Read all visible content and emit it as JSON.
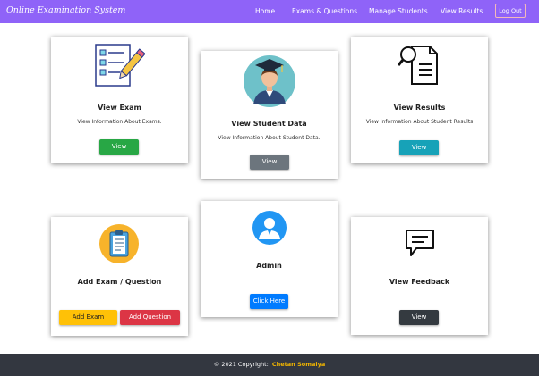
{
  "nav": {
    "brand": "Online Examination System",
    "links": [
      "Home",
      "Exams & Questions",
      "Manage Students",
      "View Results"
    ],
    "logout_label": "Log Out"
  },
  "cards": {
    "view_exam": {
      "title": "View Exam",
      "desc": "View Information About Exams.",
      "button": "View",
      "button_color": "#28a745",
      "icon": "checklist-pencil-icon"
    },
    "view_student": {
      "title": "View Student Data",
      "desc": "View Information About Student Data.",
      "button": "View",
      "button_color": "#6c757d",
      "icon": "student-avatar-icon"
    },
    "view_results": {
      "title": "View Results",
      "desc": "View Information About Student Results",
      "button": "View",
      "button_color": "#17a2b8",
      "icon": "document-search-icon"
    },
    "add_exam": {
      "title": "Add Exam / Question",
      "button_exam": "Add Exam",
      "button_exam_color": "#ffc107",
      "button_question": "Add Question",
      "button_question_color": "#dc3545",
      "icon": "clipboard-icon"
    },
    "admin": {
      "title": "Admin",
      "button": "Click Here",
      "button_color": "#007bff",
      "icon": "admin-user-icon"
    },
    "feedback": {
      "title": "View Feedback",
      "button": "View",
      "button_color": "#343a40",
      "icon": "speech-bubble-icon"
    }
  },
  "footer": {
    "copyright": "© 2021 Copyright:",
    "author": "Chetan Somaiya"
  },
  "colors": {
    "navbar": "#8f63f8",
    "divider": "#5b8de6",
    "footer": "#333740"
  }
}
